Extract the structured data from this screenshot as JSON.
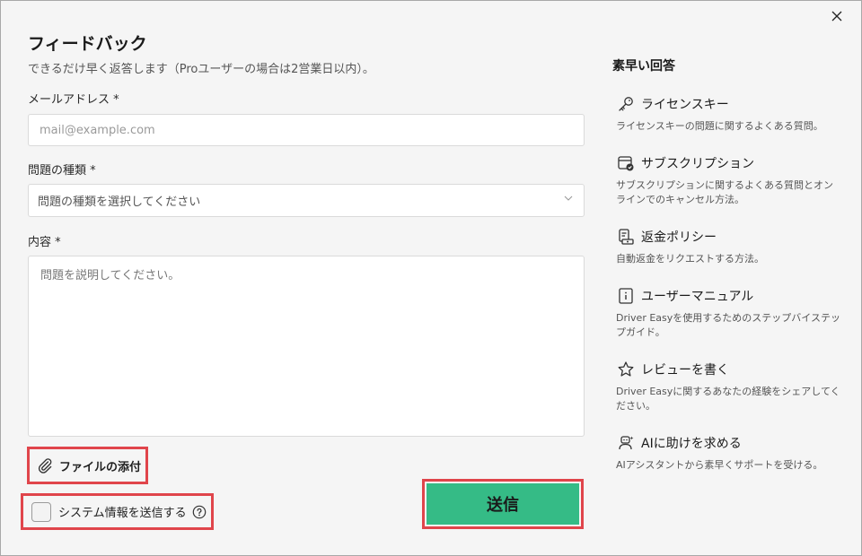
{
  "form": {
    "title": "フィードバック",
    "subtitle": "できるだけ早く返答します（Proユーザーの場合は2営業日以内）。",
    "email_label": "メールアドレス *",
    "email_placeholder": "mail@example.com",
    "type_label": "問題の種類 *",
    "type_placeholder": "問題の種類を選択してください",
    "content_label": "内容 *",
    "content_placeholder": "問題を説明してください。",
    "attach_label": "ファイルの添付",
    "sysinfo_label": "システム情報を送信する",
    "sysinfo_checked": false,
    "submit_label": "送信"
  },
  "quick_answers": {
    "title": "素早い回答",
    "items": [
      {
        "icon": "key-icon",
        "title": "ライセンスキー",
        "desc": "ライセンスキーの問題に関するよくある質問。"
      },
      {
        "icon": "subscription-icon",
        "title": "サブスクリプション",
        "desc": "サブスクリプションに関するよくある質問とオンラインでのキャンセル方法。"
      },
      {
        "icon": "refund-icon",
        "title": "返金ポリシー",
        "desc": "自動返金をリクエストする方法。"
      },
      {
        "icon": "manual-icon",
        "title": "ユーザーマニュアル",
        "desc": "Driver Easyを使用するためのステップバイステップガイド。"
      },
      {
        "icon": "star-icon",
        "title": "レビューを書く",
        "desc": "Driver Easyに関するあなたの経験をシェアしてください。"
      },
      {
        "icon": "ai-assistant-icon",
        "title": "AIに助けを求める",
        "desc": "AIアシスタントから素早くサポートを受ける。"
      }
    ]
  },
  "colors": {
    "accent": "#35bb86",
    "highlight": "#e0454b"
  }
}
